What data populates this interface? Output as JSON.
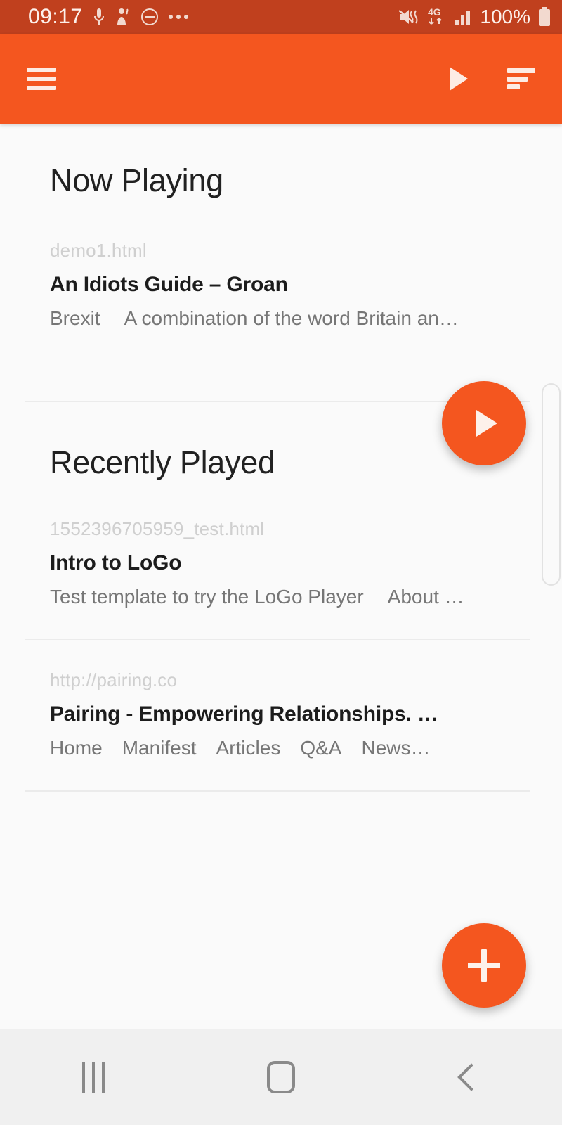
{
  "status_bar": {
    "time": "09:17",
    "battery_percent": "100%",
    "network": "4G",
    "icons": [
      "microphone-icon",
      "person-alert-icon",
      "do-not-disturb-icon",
      "more-notifications-icon",
      "mute-icon",
      "network-4g-icon",
      "signal-bars-icon",
      "battery-icon"
    ],
    "colors": {
      "background": "#c0401e",
      "foreground": "#fdf0ea"
    }
  },
  "app_bar": {
    "menu_icon": "hamburger-menu-icon",
    "play_icon": "play-icon",
    "sort_icon": "sort-icon",
    "colors": {
      "background": "#f4561f",
      "foreground": "#fdece4"
    }
  },
  "now_playing": {
    "heading": "Now Playing",
    "item": {
      "url": "demo1.html",
      "title": "An Idiots Guide – Groan",
      "desc_part1": "Brexit",
      "desc_part2": "A combination of the word Britain an…"
    },
    "fab": {
      "icon": "play-icon",
      "color": "#f4561f"
    }
  },
  "recently_played": {
    "heading": "Recently Played",
    "items": [
      {
        "url": "1552396705959_test.html",
        "title": "Intro to LoGo",
        "desc_part1": "Test template to try the LoGo Player",
        "desc_part2": "About …"
      },
      {
        "url": "http://pairing.co",
        "title": "Pairing - Empowering Relationships. …",
        "nav": [
          "Home",
          "Manifest",
          "Articles",
          "Q&A",
          "News…"
        ]
      }
    ]
  },
  "add_fab": {
    "icon": "plus-icon",
    "color": "#f4561f"
  },
  "nav_bar": {
    "recents_icon": "recents-icon",
    "home_icon": "home-icon",
    "back_icon": "back-icon"
  }
}
